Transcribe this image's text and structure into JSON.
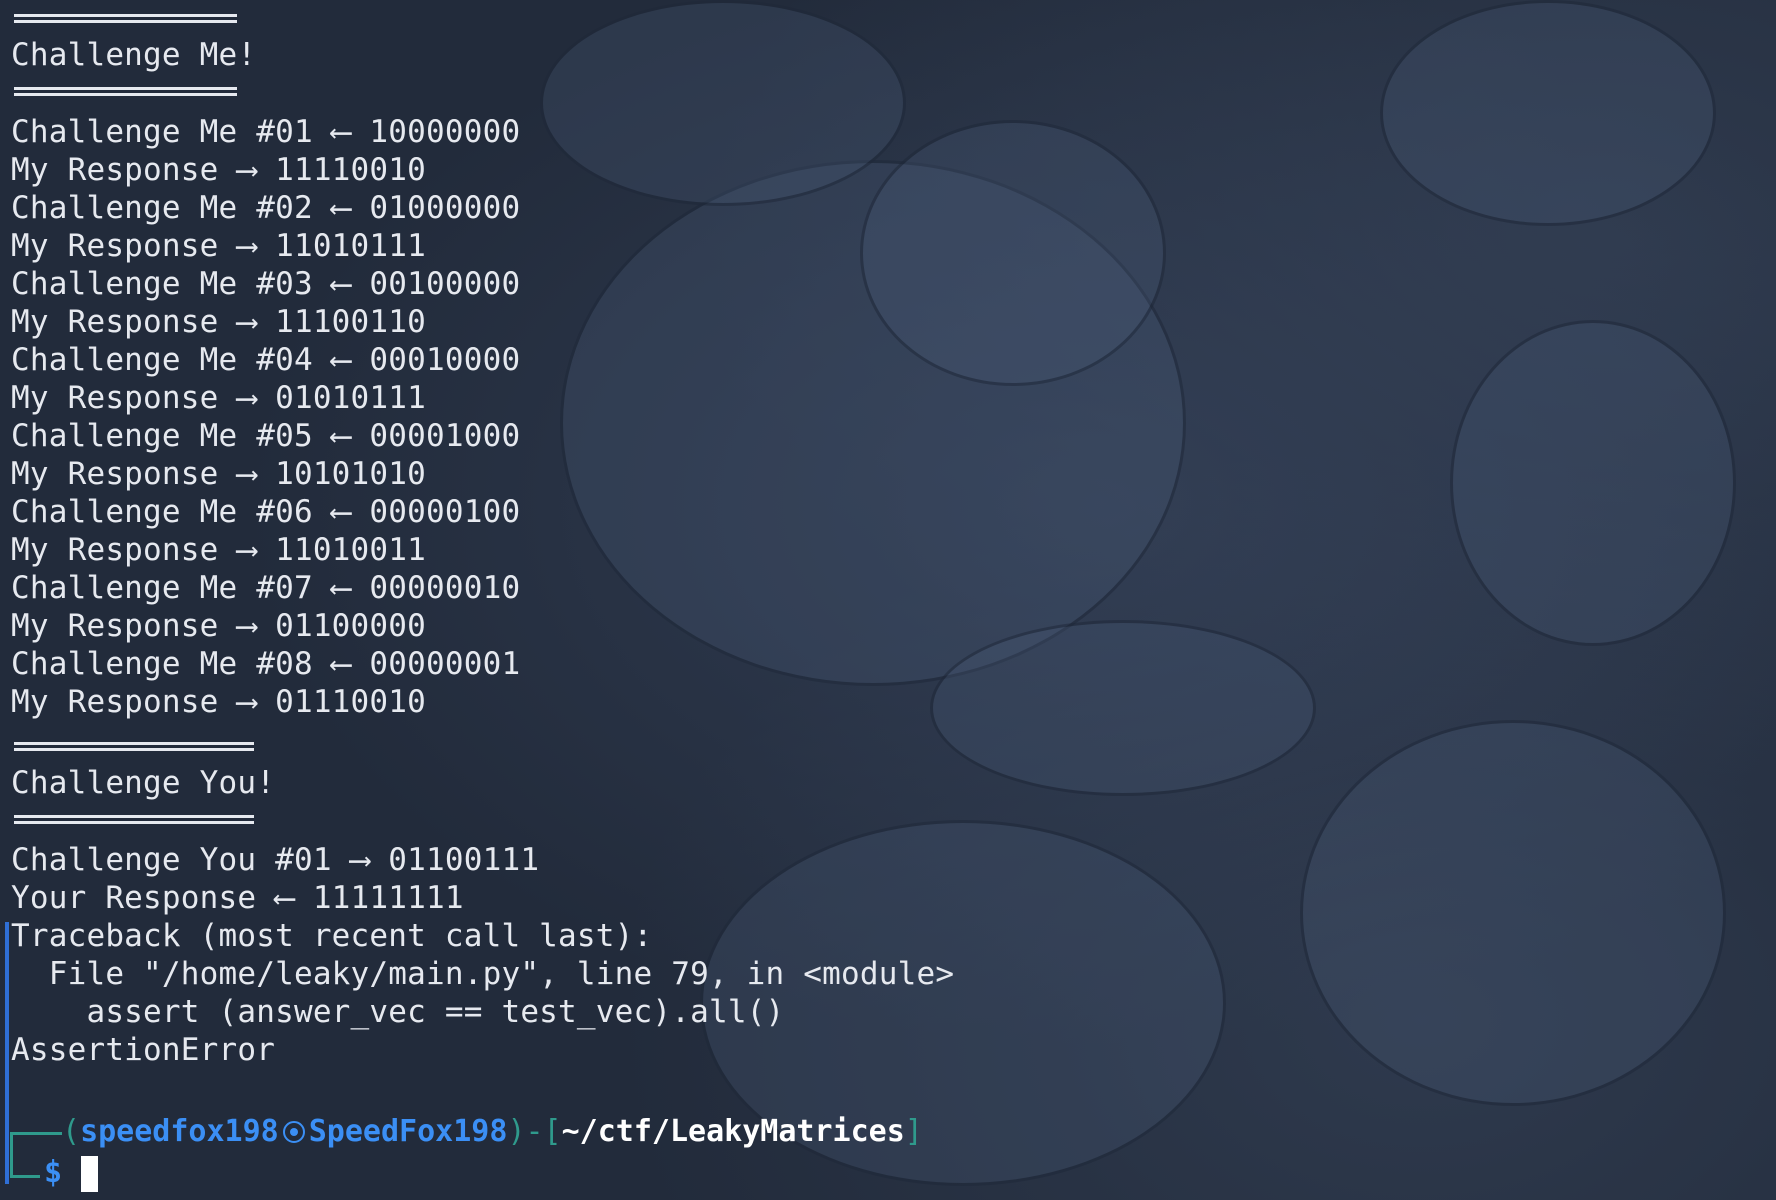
{
  "terminal": {
    "section_me_title": "Challenge Me!",
    "challenge_me": [
      {
        "challenge": "Challenge Me #01 ⟵ 10000000",
        "response": "My Response ⟶ 11110010"
      },
      {
        "challenge": "Challenge Me #02 ⟵ 01000000",
        "response": "My Response ⟶ 11010111"
      },
      {
        "challenge": "Challenge Me #03 ⟵ 00100000",
        "response": "My Response ⟶ 11100110"
      },
      {
        "challenge": "Challenge Me #04 ⟵ 00010000",
        "response": "My Response ⟶ 01010111"
      },
      {
        "challenge": "Challenge Me #05 ⟵ 00001000",
        "response": "My Response ⟶ 10101010"
      },
      {
        "challenge": "Challenge Me #06 ⟵ 00000100",
        "response": "My Response ⟶ 11010011"
      },
      {
        "challenge": "Challenge Me #07 ⟵ 00000010",
        "response": "My Response ⟶ 01100000"
      },
      {
        "challenge": "Challenge Me #08 ⟵ 00000001",
        "response": "My Response ⟶ 01110010"
      }
    ],
    "section_you_title": "Challenge You!",
    "challenge_you": [
      {
        "challenge": "Challenge You #01 ⟶ 01100111",
        "response": "Your Response ⟵ 11111111"
      }
    ],
    "traceback": [
      "Traceback (most recent call last):",
      "  File \"/home/leaky/main.py\", line 79, in <module>",
      "    assert (answer_vec == test_vec).all()",
      "AssertionError"
    ],
    "prompt": {
      "open_paren": "(",
      "user": "speedfox198",
      "host": "SpeedFox198",
      "close_paren": ")-[",
      "path": "~/ctf/LeakyMatrices",
      "close_bracket": "]",
      "symbol": "$"
    }
  },
  "colors": {
    "text": "#e6e9ef",
    "prompt_user": "#3b8ff5",
    "prompt_frame": "#2f9a8c",
    "traceback_bar": "#2f6fd6",
    "background": "#1f2838"
  }
}
